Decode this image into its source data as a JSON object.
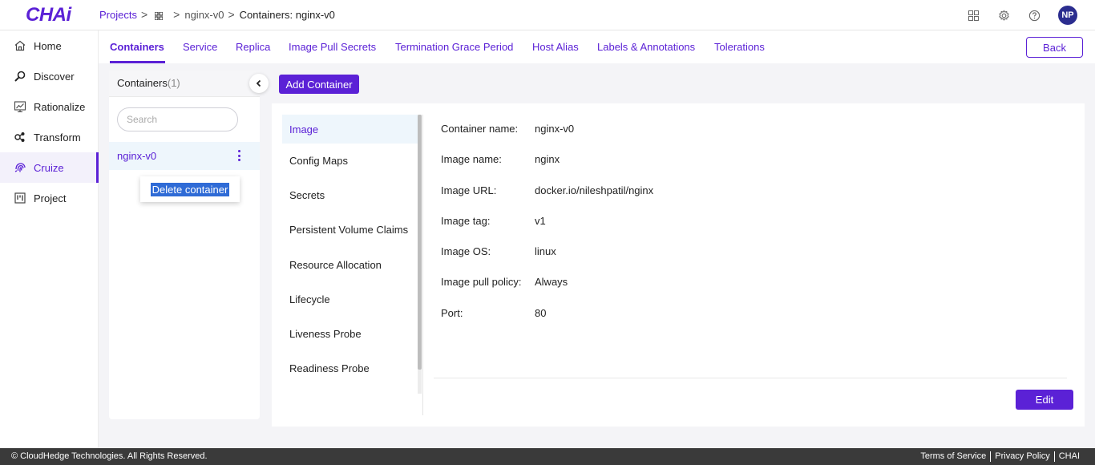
{
  "app": {
    "logo": "CHAi"
  },
  "breadcrumb": {
    "projects": "Projects",
    "sep": ">",
    "item": "nginx-v0",
    "current": "Containers: nginx-v0"
  },
  "header_icons": [
    "apps-grid-icon",
    "gear-icon",
    "help-icon"
  ],
  "user": {
    "initials": "NP"
  },
  "sidebar": {
    "items": [
      {
        "label": "Home",
        "icon": "home-icon"
      },
      {
        "label": "Discover",
        "icon": "magnify-icon"
      },
      {
        "label": "Rationalize",
        "icon": "chart-icon"
      },
      {
        "label": "Transform",
        "icon": "transform-icon"
      },
      {
        "label": "Cruize",
        "icon": "fingerprint-icon",
        "active": true
      },
      {
        "label": "Project",
        "icon": "board-icon"
      }
    ]
  },
  "tabs": [
    {
      "label": "Containers",
      "active": true
    },
    {
      "label": "Service"
    },
    {
      "label": "Replica"
    },
    {
      "label": "Image Pull Secrets"
    },
    {
      "label": "Termination Grace Period"
    },
    {
      "label": "Host Alias"
    },
    {
      "label": "Labels & Annotations"
    },
    {
      "label": "Tolerations"
    }
  ],
  "actions": {
    "back": "Back",
    "add_container": "Add Container",
    "edit": "Edit"
  },
  "containers": {
    "title": "Containers",
    "count": "(1)",
    "search_placeholder": "Search",
    "items": [
      {
        "name": "nginx-v0"
      }
    ],
    "context_menu": {
      "delete": "Delete container"
    }
  },
  "subnav": [
    {
      "label": "Image",
      "active": true
    },
    {
      "label": "Config Maps"
    },
    {
      "label": "Secrets"
    },
    {
      "label": "Persistent Volume Claims"
    },
    {
      "label": "Resource Allocation"
    },
    {
      "label": "Lifecycle"
    },
    {
      "label": "Liveness Probe"
    },
    {
      "label": "Readiness Probe"
    }
  ],
  "image_details": [
    {
      "label": "Container name:",
      "value": "nginx-v0"
    },
    {
      "label": "Image name:",
      "value": "nginx"
    },
    {
      "label": "Image URL:",
      "value": "docker.io/nileshpatil/nginx"
    },
    {
      "label": "Image tag:",
      "value": "v1"
    },
    {
      "label": "Image OS:",
      "value": "linux"
    },
    {
      "label": "Image pull policy:",
      "value": "Always"
    },
    {
      "label": "Port:",
      "value": "80"
    }
  ],
  "footer": {
    "copyright": "© CloudHedge Technologies. All Rights Reserved.",
    "links": [
      "Terms of Service",
      "Privacy Policy",
      "CHAI"
    ]
  },
  "colors": {
    "accent": "#5b21d6",
    "avatar": "#2b2d8f",
    "footer": "#3a3a3a"
  }
}
